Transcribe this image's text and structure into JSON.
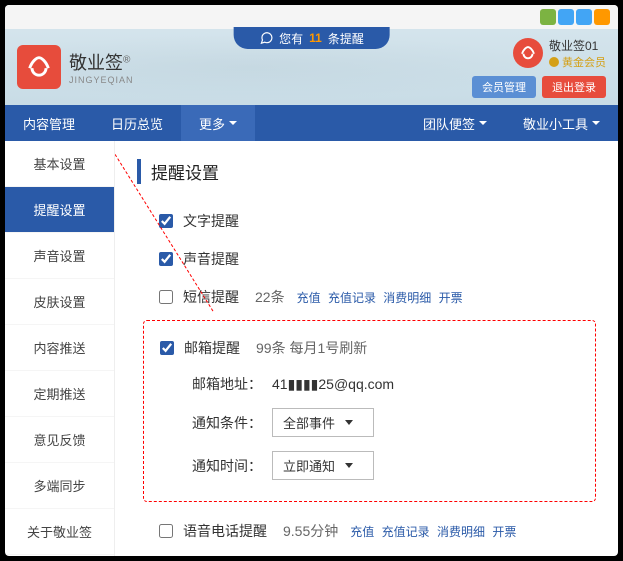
{
  "brand": {
    "cn": "敬业签",
    "sup": "®",
    "en": "JINGYEQIAN"
  },
  "notification": {
    "prefix": "您有",
    "count": "11",
    "suffix": "条提醒"
  },
  "user": {
    "name": "敬业签01",
    "vip": "黄金会员",
    "member_btn": "会员管理",
    "logout_btn": "退出登录"
  },
  "nav": {
    "content": "内容管理",
    "calendar": "日历总览",
    "more": "更多",
    "team": "团队便签",
    "tools": "敬业小工具"
  },
  "sidebar": [
    "基本设置",
    "提醒设置",
    "声音设置",
    "皮肤设置",
    "内容推送",
    "定期推送",
    "意见反馈",
    "多端同步",
    "关于敬业签"
  ],
  "page_title": "提醒设置",
  "reminders": {
    "text": {
      "label": "文字提醒",
      "checked": true
    },
    "sound": {
      "label": "声音提醒",
      "checked": true
    },
    "sms": {
      "label": "短信提醒",
      "checked": false,
      "quota": "22条"
    },
    "email": {
      "label": "邮箱提醒",
      "checked": true,
      "quota": "99条 每月1号刷新",
      "addr_label": "邮箱地址：",
      "addr_value": "41▮▮▮▮25@qq.com",
      "cond_label": "通知条件：",
      "cond_value": "全部事件",
      "time_label": "通知时间：",
      "time_value": "立即通知"
    },
    "voice": {
      "label": "语音电话提醒",
      "checked": false,
      "quota": "9.55分钟"
    }
  },
  "links": {
    "recharge": "充值",
    "log": "充值记录",
    "detail": "消费明细",
    "invoice": "开票"
  }
}
